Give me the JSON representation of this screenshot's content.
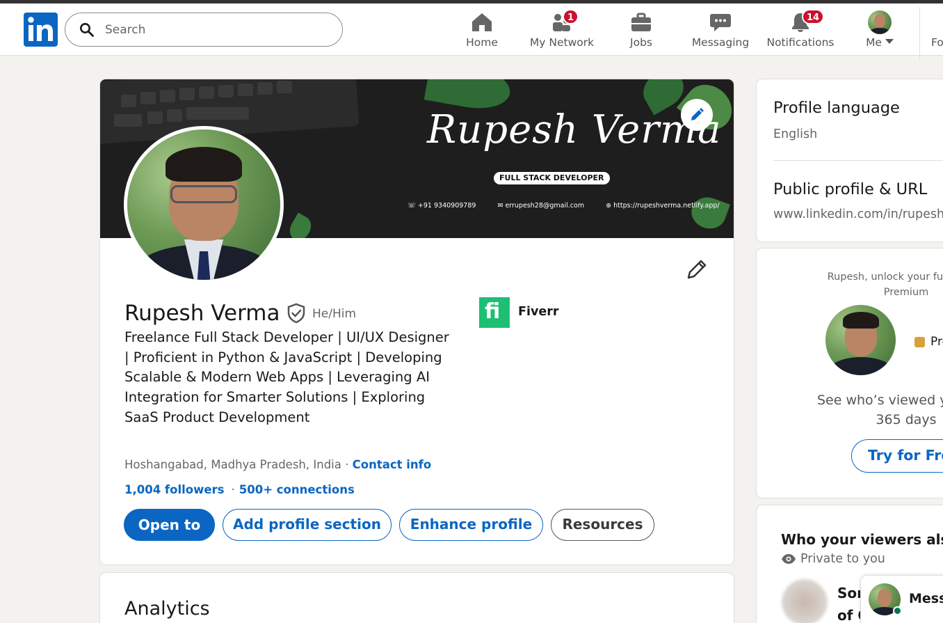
{
  "navbar": {
    "search_placeholder": "Search",
    "items": [
      {
        "label": "Home",
        "icon": "home-icon"
      },
      {
        "label": "My Network",
        "icon": "network-icon",
        "badge": "1"
      },
      {
        "label": "Jobs",
        "icon": "briefcase-icon"
      },
      {
        "label": "Messaging",
        "icon": "chat-icon"
      },
      {
        "label": "Notifications",
        "icon": "bell-icon",
        "badge": "14"
      },
      {
        "label": "Me",
        "icon": "avatar"
      }
    ],
    "for_business_truncated": "Fo"
  },
  "banner": {
    "name": "Rupesh Verma",
    "tagline": "FULL STACK DEVELOPER",
    "phone": "+91 9340909789",
    "email": "errupesh28@gmail.com",
    "website": "https://rupeshverma.netlify.app/"
  },
  "profile": {
    "name": "Rupesh Verma",
    "pronouns": "He/Him",
    "headline": "Freelance Full Stack Developer | UI/UX Designer | Proficient in Python & JavaScript | Developing Scalable & Modern Web Apps | Leveraging AI Integration for Smarter Solutions | Exploring SaaS Product Development",
    "location": "Hoshangabad, Madhya Pradesh, India",
    "location_separator": " · ",
    "contact_info": "Contact info",
    "followers": "1,004 followers",
    "connections": "500+ connections",
    "company": "Fiverr",
    "company_logo_letter": "fi"
  },
  "actions": {
    "open_to": "Open to",
    "add_section": "Add profile section",
    "enhance": "Enhance profile",
    "resources": "Resources"
  },
  "analytics": {
    "title": "Analytics"
  },
  "sidebar": {
    "profile_language_title": "Profile language",
    "profile_language_value": "English",
    "public_profile_title": "Public profile & URL",
    "public_profile_url": "www.linkedin.com/in/rupesh",
    "premium_prompt": "Rupesh, unlock your full potent",
    "premium_prompt_2": "Premium",
    "premium_badge_label": "Pre",
    "see_who": "See who’s viewed your pro",
    "see_who_2": "365 days",
    "try_free": "Try for Free",
    "viewers_title": "Who your viewers also",
    "private_label": "Private to you",
    "viewer_name_line1": "Son",
    "viewer_name_line2": "of C"
  },
  "messaging_bar": {
    "label": "Messa"
  },
  "colors": {
    "brand_blue": "#0a66c2",
    "badge_red": "#cb112d",
    "fiverr_green": "#1dbf73",
    "online_green": "#01754f",
    "page_bg": "#f4f2ee"
  }
}
